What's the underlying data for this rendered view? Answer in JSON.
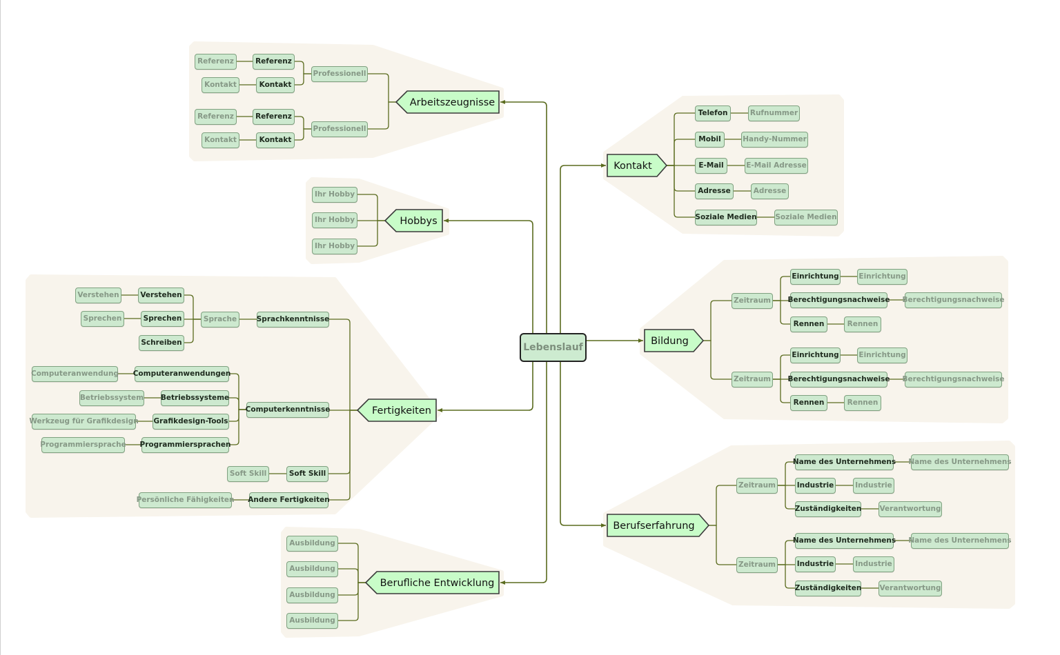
{
  "colors": {
    "connector": "#5a6b1e",
    "blob": "#f8f4ec",
    "node_fill": "#cde9cf",
    "main_fill": "#c8fcc8",
    "root_fill": "#cdebd0"
  },
  "root": {
    "label": "Lebenslauf"
  },
  "branches": {
    "arbeitszeugnisse": {
      "label": "Arbeitszeugnisse",
      "children": [
        {
          "label": "Professionell",
          "children": [
            {
              "label": "Referenz",
              "children": [
                {
                  "label": "Referenz"
                }
              ]
            },
            {
              "label": "Kontakt",
              "children": [
                {
                  "label": "Kontakt"
                }
              ]
            }
          ]
        },
        {
          "label": "Professionell",
          "children": [
            {
              "label": "Referenz",
              "children": [
                {
                  "label": "Referenz"
                }
              ]
            },
            {
              "label": "Kontakt",
              "children": [
                {
                  "label": "Kontakt"
                }
              ]
            }
          ]
        }
      ]
    },
    "hobbys": {
      "label": "Hobbys",
      "children": [
        {
          "label": "Ihr Hobby"
        },
        {
          "label": "Ihr Hobby"
        },
        {
          "label": "Ihr Hobby"
        }
      ]
    },
    "fertigkeiten": {
      "label": "Fertigkeiten",
      "children": [
        {
          "label": "Sprachkenntnisse",
          "children": [
            {
              "label": "Sprache",
              "children": [
                {
                  "label": "Verstehen",
                  "children": [
                    {
                      "label": "Verstehen"
                    }
                  ]
                },
                {
                  "label": "Sprechen",
                  "children": [
                    {
                      "label": "Sprechen"
                    }
                  ]
                },
                {
                  "label": "Schreiben"
                }
              ]
            }
          ]
        },
        {
          "label": "Computerkenntnisse",
          "children": [
            {
              "label": "Computeranwendungen",
              "children": [
                {
                  "label": "Computeranwendung"
                }
              ]
            },
            {
              "label": "Betriebssysteme",
              "children": [
                {
                  "label": "Betriebssystem"
                }
              ]
            },
            {
              "label": "Grafikdesign-Tools",
              "children": [
                {
                  "label": "Werkzeug für Grafikdesign"
                }
              ]
            },
            {
              "label": "Programmiersprachen",
              "children": [
                {
                  "label": "Programmiersprache"
                }
              ]
            }
          ]
        },
        {
          "label": "Soft Skill",
          "children": [
            {
              "label": "Soft Skill"
            }
          ]
        },
        {
          "label": "Andere Fertigkeiten",
          "children": [
            {
              "label": "Persönliche Fähigkeiten"
            }
          ]
        }
      ]
    },
    "berufliche_entwicklung": {
      "label": "Berufliche Entwicklung",
      "children": [
        {
          "label": "Ausbildung"
        },
        {
          "label": "Ausbildung"
        },
        {
          "label": "Ausbildung"
        },
        {
          "label": "Ausbildung"
        }
      ]
    },
    "kontakt": {
      "label": "Kontakt",
      "children": [
        {
          "label": "Telefon",
          "children": [
            {
              "label": "Rufnummer"
            }
          ]
        },
        {
          "label": "Mobil",
          "children": [
            {
              "label": "Handy-Nummer"
            }
          ]
        },
        {
          "label": "E-Mail",
          "children": [
            {
              "label": "E-Mail Adresse"
            }
          ]
        },
        {
          "label": "Adresse",
          "children": [
            {
              "label": "Adresse"
            }
          ]
        },
        {
          "label": "Soziale Medien",
          "children": [
            {
              "label": "Soziale Medien"
            }
          ]
        }
      ]
    },
    "bildung": {
      "label": "Bildung",
      "children": [
        {
          "label": "Zeitraum",
          "children": [
            {
              "label": "Einrichtung",
              "children": [
                {
                  "label": "Einrichtung"
                }
              ]
            },
            {
              "label": "Berechtigungsnachweise",
              "children": [
                {
                  "label": "Berechtigungsnachweise"
                }
              ]
            },
            {
              "label": "Rennen",
              "children": [
                {
                  "label": "Rennen"
                }
              ]
            }
          ]
        },
        {
          "label": "Zeitraum",
          "children": [
            {
              "label": "Einrichtung",
              "children": [
                {
                  "label": "Einrichtung"
                }
              ]
            },
            {
              "label": "Berechtigungsnachweise",
              "children": [
                {
                  "label": "Berechtigungsnachweise"
                }
              ]
            },
            {
              "label": "Rennen",
              "children": [
                {
                  "label": "Rennen"
                }
              ]
            }
          ]
        }
      ]
    },
    "berufserfahrung": {
      "label": "Berufserfahrung",
      "children": [
        {
          "label": "Zeitraum",
          "children": [
            {
              "label": "Name des Unternehmens",
              "children": [
                {
                  "label": "Name des Unternehmens"
                }
              ]
            },
            {
              "label": "Industrie",
              "children": [
                {
                  "label": "Industrie"
                }
              ]
            },
            {
              "label": "Zuständigkeiten",
              "children": [
                {
                  "label": "Verantwortung"
                }
              ]
            }
          ]
        },
        {
          "label": "Zeitraum",
          "children": [
            {
              "label": "Name des Unternehmens",
              "children": [
                {
                  "label": "Name des Unternehmens"
                }
              ]
            },
            {
              "label": "Industrie",
              "children": [
                {
                  "label": "Industrie"
                }
              ]
            },
            {
              "label": "Zuständigkeiten",
              "children": [
                {
                  "label": "Verantwortung"
                }
              ]
            }
          ]
        }
      ]
    }
  }
}
